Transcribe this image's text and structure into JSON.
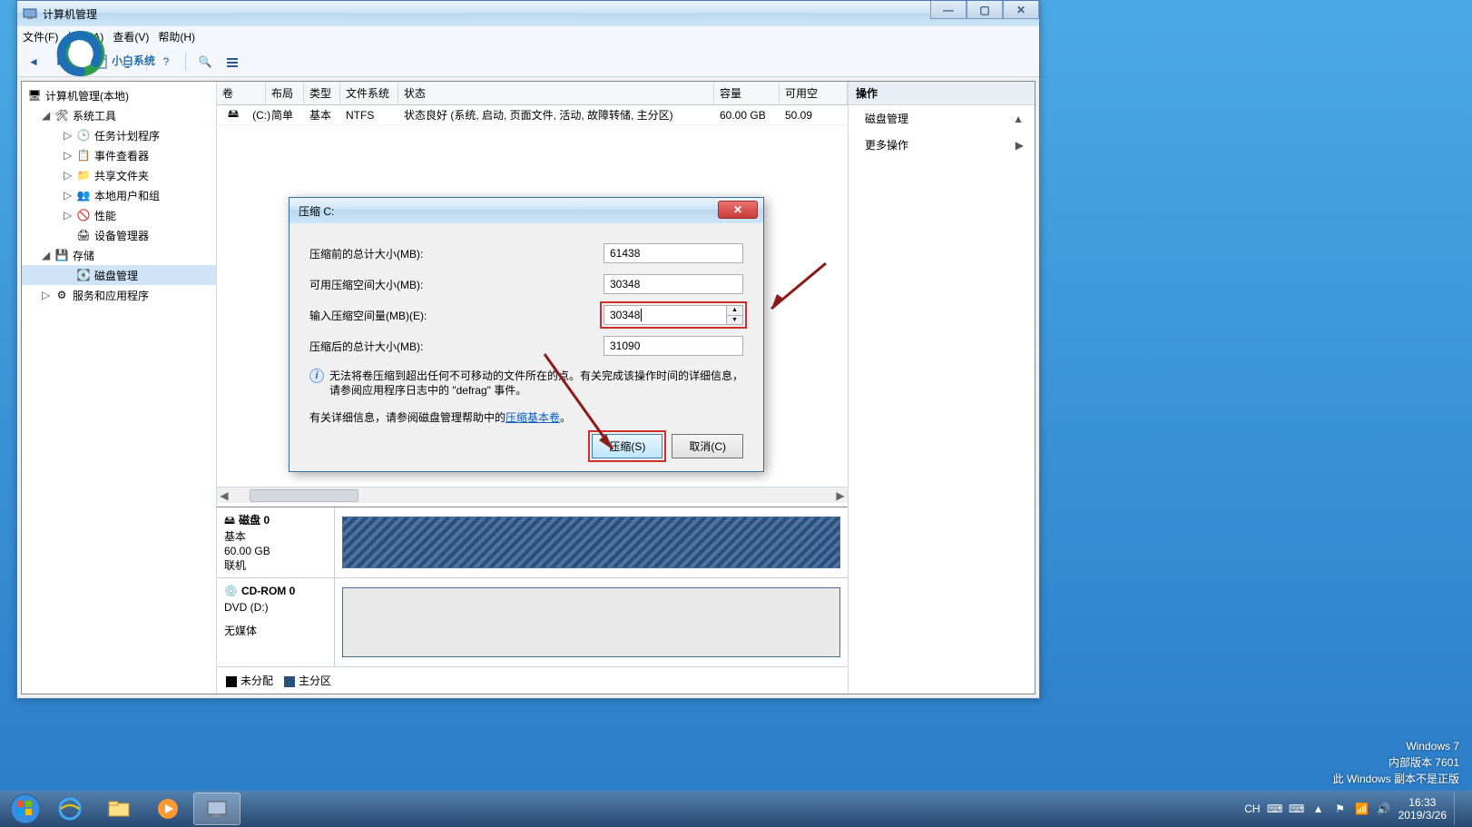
{
  "window": {
    "title": "计算机管理",
    "menu": {
      "file": "文件(F)",
      "action": "操作(A)",
      "view": "查看(V)",
      "help": "帮助(H)"
    },
    "win_btns": {
      "min": "—",
      "max": "▢",
      "close": "✕"
    }
  },
  "logo_text": "小白系统",
  "tree": {
    "root": "计算机管理(本地)",
    "systools": "系统工具",
    "task_scheduler": "任务计划程序",
    "event_viewer": "事件查看器",
    "shared_folders": "共享文件夹",
    "local_users": "本地用户和组",
    "performance": "性能",
    "device_manager": "设备管理器",
    "storage": "存储",
    "disk_mgmt": "磁盘管理",
    "services": "服务和应用程序"
  },
  "grid": {
    "cols": {
      "vol": "卷",
      "layout": "布局",
      "type": "类型",
      "fs": "文件系统",
      "status": "状态",
      "cap": "容量",
      "free": "可用空"
    },
    "row": {
      "vol": "(C:)",
      "layout": "简单",
      "type": "基本",
      "fs": "NTFS",
      "status": "状态良好 (系统, 启动, 页面文件, 活动, 故障转储, 主分区)",
      "cap": "60.00 GB",
      "free": "50.09"
    }
  },
  "diskpanel": {
    "disk0": {
      "name": "磁盘 0",
      "type": "基本",
      "size": "60.00 GB",
      "status": "联机"
    },
    "cdrom": {
      "name": "CD-ROM 0",
      "drive": "DVD (D:)",
      "media": "无媒体"
    },
    "legend": {
      "unalloc": "未分配",
      "primary": "主分区"
    }
  },
  "actions": {
    "title": "操作",
    "disk_mgmt": "磁盘管理",
    "more": "更多操作",
    "chev": "▶",
    "chevup": "▲"
  },
  "dialog": {
    "title": "压缩 C:",
    "f1_label": "压缩前的总计大小(MB):",
    "f1_val": "61438",
    "f2_label": "可用压缩空间大小(MB):",
    "f2_val": "30348",
    "f3_label": "输入压缩空间量(MB)(E):",
    "f3_val": "30348",
    "f4_label": "压缩后的总计大小(MB):",
    "f4_val": "31090",
    "info": "无法将卷压缩到超出任何不可移动的文件所在的点。有关完成该操作时间的详细信息，请参阅应用程序日志中的 \"defrag\" 事件。",
    "help_prefix": "有关详细信息，请参阅磁盘管理帮助中的",
    "help_link": "压缩基本卷",
    "help_suffix": "。",
    "btn_shrink": "压缩(S)",
    "btn_cancel": "取消(C)",
    "close": "✕"
  },
  "watermark": {
    "l1": "Windows 7",
    "l2": "内部版本 7601",
    "l3": "此 Windows 副本不是正版"
  },
  "tray": {
    "ime": "CH",
    "time": "16:33",
    "date": "2019/3/26"
  }
}
